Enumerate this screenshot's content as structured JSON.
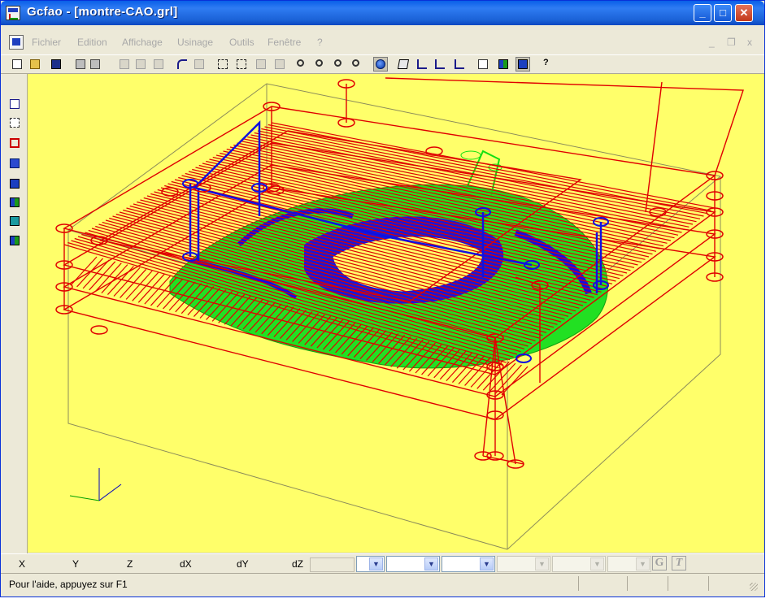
{
  "window": {
    "title": "Gcfao  - [montre-CAO.grl]",
    "min_glyph": "_",
    "max_glyph": "□",
    "close_glyph": "✕"
  },
  "menubar": {
    "items": [
      "Fichier",
      "Edition",
      "Affichage",
      "Usinage",
      "Outils",
      "Fenêtre",
      "?"
    ],
    "mdi_minimize": "_",
    "mdi_restore": "❐",
    "mdi_close": "x"
  },
  "toolbar": {
    "icons": [
      "new-icon",
      "open-icon",
      "save-icon",
      "print-icon",
      "print-preview-icon",
      "cut-icon",
      "copy-icon",
      "paste-icon",
      "undo-icon",
      "redo-icon",
      "select-icon",
      "select-add-icon",
      "select-remove-icon",
      "deselect-icon",
      "zoom-window-icon",
      "zoom-extents-icon",
      "zoom-previous-icon",
      "zoom-all-icon",
      "globe-view-icon",
      "iso-view-icon",
      "xy-view-icon",
      "xz-view-icon",
      "yz-view-icon",
      "grid-icon",
      "fao-mode-icon",
      "fao-view-icon",
      "help-pointer-icon"
    ],
    "active": [
      "globe-view-icon",
      "fao-view-icon"
    ]
  },
  "sidebar": {
    "icons": [
      "edit-icon",
      "selection-rect-icon",
      "machining-icon",
      "calculator-icon",
      "tool-library-icon",
      "simulation-icon",
      "monitor-icon",
      "post-processor-icon"
    ]
  },
  "coords": {
    "labels": [
      "X",
      "Y",
      "Z",
      "dX",
      "dY",
      "dZ"
    ],
    "g_button": "G",
    "t_button": "T"
  },
  "status": {
    "text": "Pour l'aide, appuyez sur F1"
  },
  "colors": {
    "viewport_bg": "#ffff6a",
    "toolpath_red": "#e00000",
    "toolpath_blue": "#1010e0",
    "toolpath_green": "#10e010",
    "stock_box": "#8c8c5a"
  }
}
